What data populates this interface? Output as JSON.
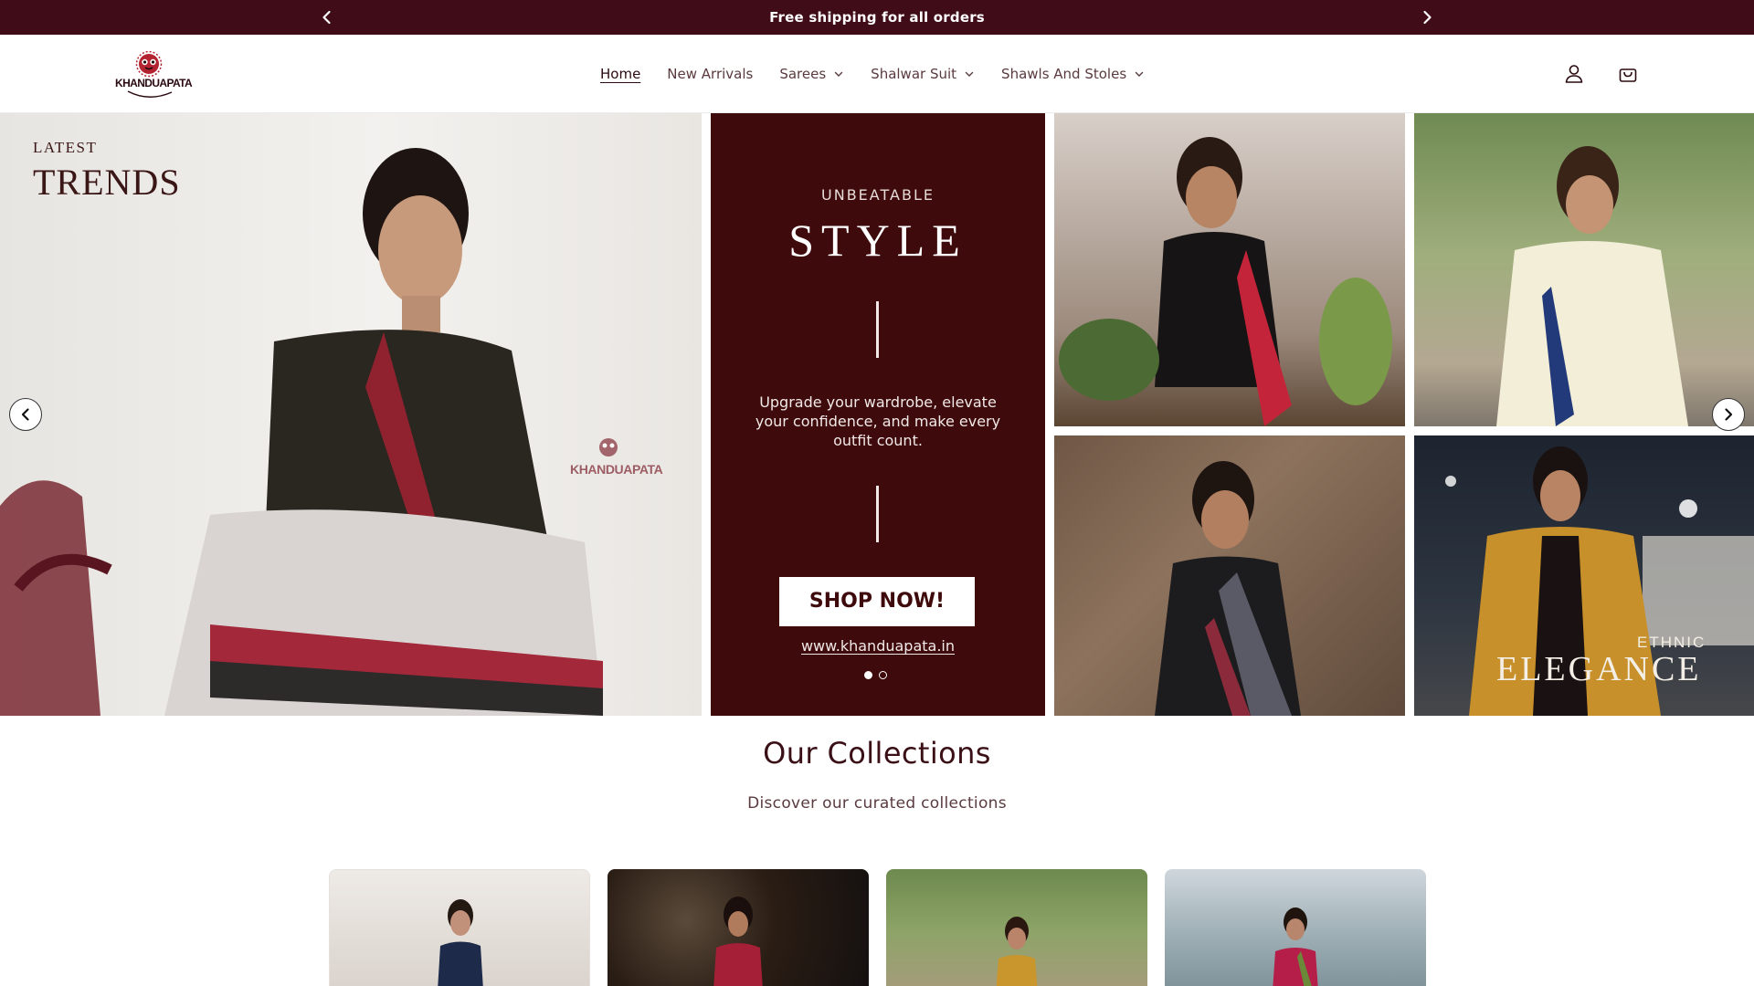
{
  "announcement": {
    "text": "Free shipping for all orders",
    "prev_icon": "chevron-left-icon",
    "next_icon": "chevron-right-icon"
  },
  "header": {
    "logo_text": "KHANDUAPATA",
    "nav": [
      {
        "label": "Home",
        "active": true,
        "dropdown": false
      },
      {
        "label": "New Arrivals",
        "active": false,
        "dropdown": false
      },
      {
        "label": "Sarees",
        "active": false,
        "dropdown": true
      },
      {
        "label": "Shalwar Suit",
        "active": false,
        "dropdown": true
      },
      {
        "label": "Shawls And Stoles",
        "active": false,
        "dropdown": true
      }
    ],
    "icons": [
      "account-icon",
      "cart-icon"
    ]
  },
  "hero": {
    "left_panel": {
      "kicker": "LATEST",
      "heading": "TRENDS",
      "watermark": "KHANDUAPATA"
    },
    "center_panel": {
      "kicker": "UNBEATABLE",
      "heading": "STYLE",
      "tagline": "Upgrade your wardrobe, elevate your confidence, and make every outfit count.",
      "cta": "SHOP NOW!",
      "url": "www.khanduapata.in"
    },
    "bottom_right_panel": {
      "kicker": "ETHNIC",
      "heading": "ELEGANCE"
    },
    "slides_total": 2,
    "active_slide": 1
  },
  "collections": {
    "title": "Our Collections",
    "subtitle": "Discover our curated collections",
    "cards": 4
  },
  "colors": {
    "brand": "#3f0c18",
    "hero_center": "#3e0a0c",
    "text": "#3a1016"
  }
}
